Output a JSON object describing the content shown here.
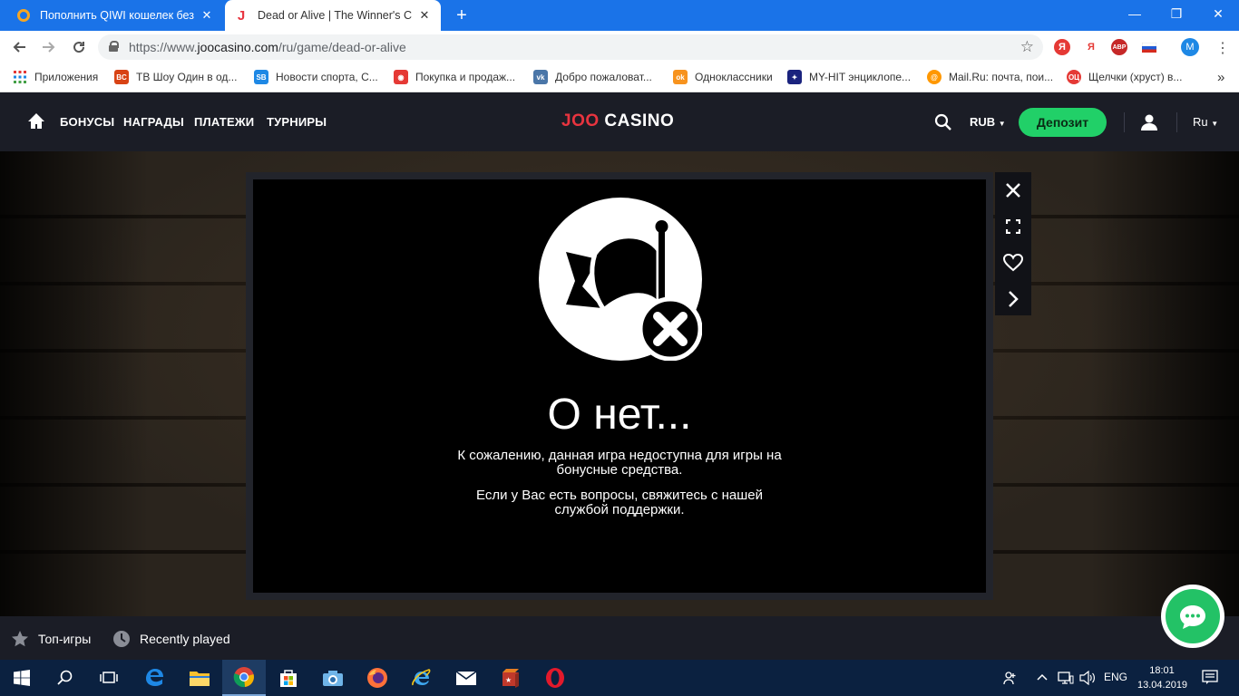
{
  "browser": {
    "tabs": [
      {
        "title": "Пополнить QIWI кошелек без к",
        "favicon": "qiwi-icon",
        "active": false
      },
      {
        "title": "Dead or Alive | The Winner's Club",
        "favicon": "joo-icon",
        "active": true
      }
    ],
    "new_tab": "+",
    "window_controls": {
      "minimize": "—",
      "maximize": "❐",
      "close": "✕"
    },
    "url": {
      "prefix": "https://www.",
      "host": "joocasino.com",
      "path": "/ru/game/dead-or-alive"
    },
    "extensions": [
      {
        "label": "Я",
        "color": "#e53935"
      },
      {
        "label": "Я",
        "color": "#e53935"
      },
      {
        "label": "ABP",
        "color": "#c62828"
      },
      {
        "label": "RU",
        "color": "#1e88e5"
      }
    ],
    "profile_initial": "M",
    "bookmarks": [
      {
        "label": "Приложения",
        "icon": "apps-grid-icon",
        "color": "#e53935"
      },
      {
        "label": "ТВ Шоу Один в од...",
        "icon": "bc-icon",
        "color": "#d84315"
      },
      {
        "label": "Новости спорта, С...",
        "icon": "sb-icon",
        "color": "#1e88e5"
      },
      {
        "label": "Покупка и продаж...",
        "icon": "car-icon",
        "color": "#e53935"
      },
      {
        "label": "Добро пожаловат...",
        "icon": "vk-icon",
        "color": "#4a76a8"
      },
      {
        "label": "Одноклассники",
        "icon": "ok-icon",
        "color": "#f7931e"
      },
      {
        "label": "MY-HIT энциклопе...",
        "icon": "film-icon",
        "color": "#1a237e"
      },
      {
        "label": "Mail.Ru: почта, пои...",
        "icon": "mailru-icon",
        "color": "#ff9800"
      },
      {
        "label": "Щелчки (хруст) в...",
        "icon": "ok-circle-icon",
        "color": "#e53935"
      }
    ],
    "bookmarks_more": "»"
  },
  "site": {
    "nav": [
      "БОНУСЫ",
      "НАГРАДЫ",
      "ПЛАТЕЖИ",
      "ТУРНИРЫ"
    ],
    "logo": {
      "part1": "JOO",
      "part2": "CASINO"
    },
    "logo_colors": {
      "joo": "#e8343f",
      "casino": "#ffffff"
    },
    "currency": "RUB",
    "deposit_label": "Депозит",
    "deposit_color": "#21d068",
    "language": "Ru"
  },
  "modal": {
    "title": "О нет...",
    "text1": "К сожалению, данная игра недоступна для игры на бонусные средства.",
    "text2": "Если у Вас есть вопросы, свяжитесь с нашей службой поддержки.",
    "icon": "flag-error-icon"
  },
  "side_actions": [
    "close-icon",
    "fullscreen-icon",
    "heart-icon",
    "chevron-right-icon"
  ],
  "bottom_bar": {
    "top_games": "Топ-игры",
    "recently_played": "Recently played"
  },
  "taskbar": {
    "apps": [
      "windows-start-icon",
      "search-icon",
      "task-view-icon",
      "edge-icon",
      "file-explorer-icon",
      "chrome-icon",
      "store-icon",
      "camera-icon",
      "firefox-icon",
      "ie-icon",
      "mail-icon",
      "game-icon",
      "opera-icon"
    ],
    "language": "ENG",
    "time": "18:01",
    "date": "13.04.2019"
  }
}
